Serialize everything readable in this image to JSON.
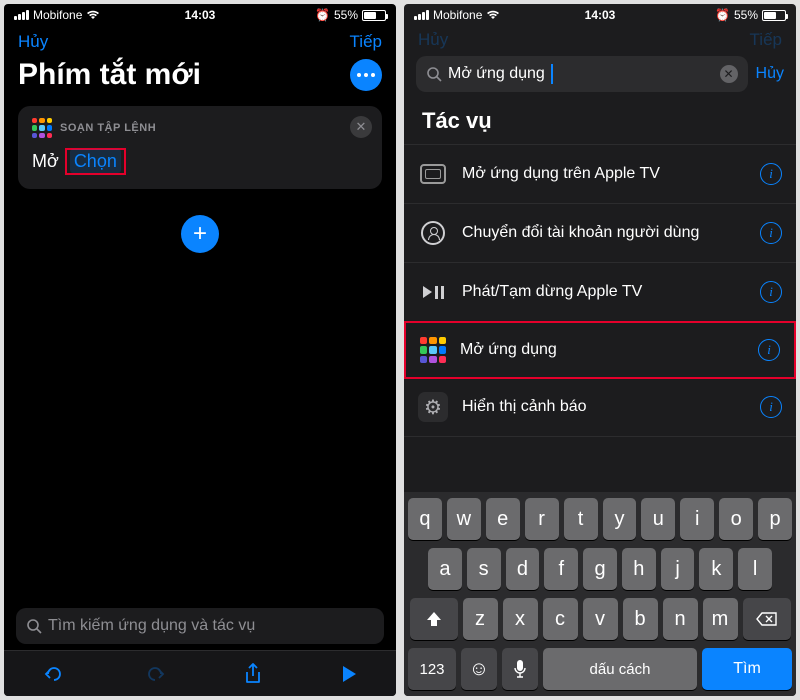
{
  "statusbar": {
    "carrier": "Mobifone",
    "time": "14:03",
    "battery_pct": "55%",
    "alarm": true
  },
  "left": {
    "nav_cancel": "Hủy",
    "nav_next": "Tiếp",
    "title": "Phím tắt mới",
    "card_header": "SOẠN TẬP LỆNH",
    "action_text": "Mở",
    "action_token": "Chọn",
    "search_placeholder": "Tìm kiếm ứng dụng và tác vụ"
  },
  "right": {
    "nav_cancel": "Hủy",
    "nav_next": "Tiếp",
    "search_value": "Mở ứng dụng",
    "search_cancel": "Hủy",
    "section_title": "Tác vụ",
    "actions": [
      "Mở ứng dụng trên Apple TV",
      "Chuyển đổi tài khoản người dùng",
      "Phát/Tạm dừng Apple TV",
      "Mở ứng dụng",
      "Hiển thị cảnh báo"
    ],
    "keyboard": {
      "row1": [
        "q",
        "w",
        "e",
        "r",
        "t",
        "y",
        "u",
        "i",
        "o",
        "p"
      ],
      "row2": [
        "a",
        "s",
        "d",
        "f",
        "g",
        "h",
        "j",
        "k",
        "l"
      ],
      "row3": [
        "z",
        "x",
        "c",
        "v",
        "b",
        "n",
        "m"
      ],
      "key_123": "123",
      "key_space": "dấu cách",
      "key_return": "Tìm"
    }
  }
}
